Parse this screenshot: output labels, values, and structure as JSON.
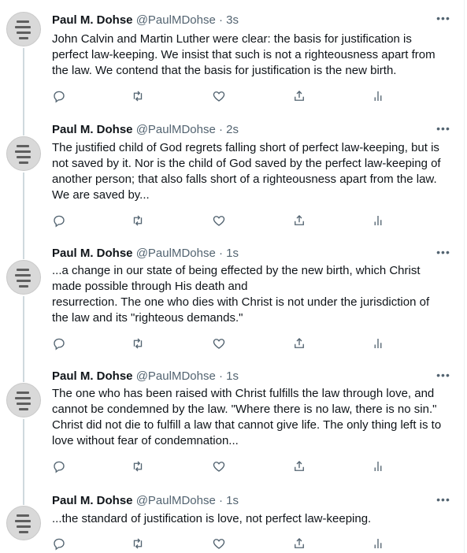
{
  "author": {
    "name": "Paul M. Dohse",
    "handle": "@PaulMDohse"
  },
  "separator": " · ",
  "tweets": [
    {
      "time": "3s",
      "lines": [
        "John Calvin and Martin Luther were clear: the basis for justification is",
        "perfect law-keeping. We insist that such is not a righteousness apart from",
        "the law. We contend that the basis for justification is the new birth."
      ]
    },
    {
      "time": "2s",
      "lines": [
        "The justified child of God regrets falling short of perfect law-keeping, but is",
        "not saved by it. Nor is the child of God saved by the perfect law-keeping of",
        "another person; that also falls short of a righteousness apart from the law.",
        "We are saved by..."
      ]
    },
    {
      "time": "1s",
      "lines": [
        "...a change in our state of being effected by the new birth, which Christ",
        "made possible through His death and",
        "resurrection. The one who dies with Christ is not under the jurisdiction of",
        "the law and its \"righteous demands.\""
      ]
    },
    {
      "time": "1s",
      "lines": [
        "The one who has been raised with Christ fulfills the law through love, and",
        "cannot be condemned by the law. \"Where there is no law, there is no sin.\"",
        "Christ did not die to fulfill a law that cannot give life. The only thing left is to",
        "love without fear of condemnation..."
      ]
    },
    {
      "time": "1s",
      "lines": [
        "...the standard of justification is love, not perfect law-keeping."
      ]
    }
  ],
  "icons": {
    "more": "more-icon",
    "reply": "reply-icon",
    "retweet": "retweet-icon",
    "like": "like-icon",
    "share": "share-icon",
    "analytics": "analytics-icon"
  },
  "colors": {
    "text": "#0f1419",
    "secondary": "#536471",
    "thread_line": "#cfd9de"
  }
}
